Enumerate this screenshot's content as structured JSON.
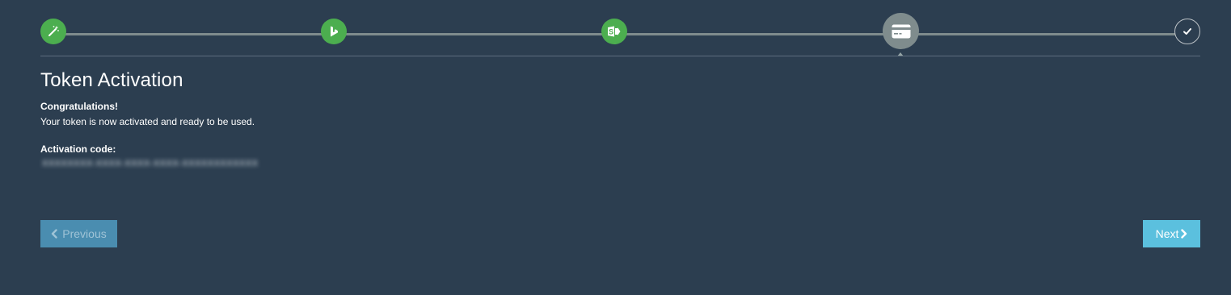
{
  "wizard": {
    "steps": [
      {
        "icon": "magic-wand-icon",
        "state": "done"
      },
      {
        "icon": "dynamics-icon",
        "state": "done"
      },
      {
        "icon": "sharepoint-icon",
        "state": "done"
      },
      {
        "icon": "credit-card-icon",
        "state": "current"
      },
      {
        "icon": "checkmark-icon",
        "state": "future"
      }
    ]
  },
  "content": {
    "title": "Token Activation",
    "congrats": "Congratulations!",
    "message": "Your token is now activated and ready to be used.",
    "activation_label": "Activation code:",
    "activation_code": "XXXXXXXX-XXXX-XXXX-XXXX-XXXXXXXXXXXX"
  },
  "buttons": {
    "previous_label": "Previous",
    "next_label": "Next"
  },
  "colors": {
    "background": "#2c3e50",
    "step_done": "#4cae4f",
    "step_current": "#7f8c8d",
    "previous_button": "#4a8db0",
    "next_button": "#5bc0de"
  }
}
